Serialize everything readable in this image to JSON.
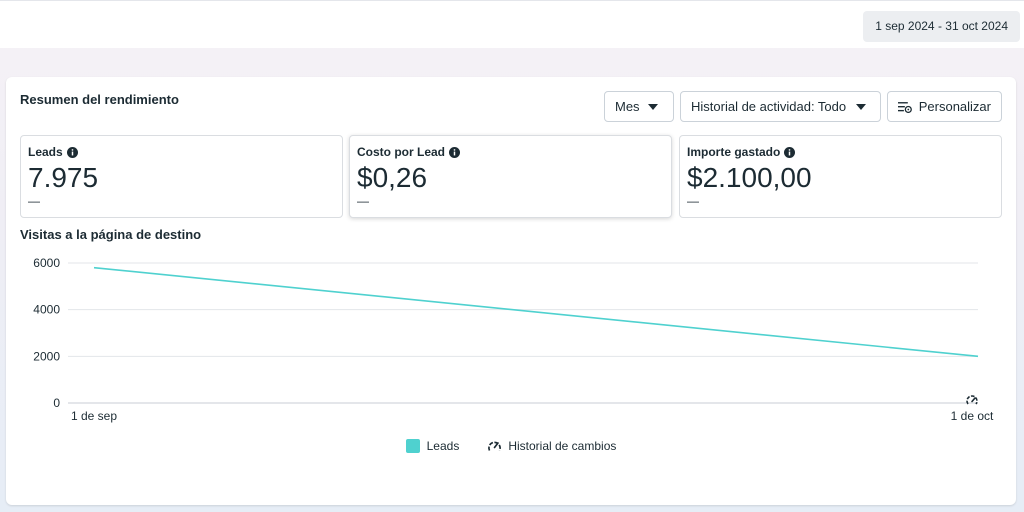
{
  "header": {
    "date_range": "1 sep 2024 - 31 oct 2024"
  },
  "summary": {
    "title": "Resumen del rendimiento",
    "controls": {
      "period": "Mes",
      "history": "Historial de actividad: Todo",
      "customize": "Personalizar"
    },
    "metrics": [
      {
        "label": "Leads",
        "value": "7.975",
        "delta": "—"
      },
      {
        "label": "Costo por Lead",
        "value": "$0,26",
        "delta": "—"
      },
      {
        "label": "Importe gastado",
        "value": "$2.100,00",
        "delta": "—"
      }
    ]
  },
  "colors": {
    "series": "#4fd1cf",
    "accent": "#1c2b33"
  },
  "chart_data": {
    "type": "line",
    "title": "Visitas a la página de destino",
    "x": [
      "1 de sep",
      "1 de oct"
    ],
    "series": [
      {
        "name": "Leads",
        "values": [
          5800,
          2000
        ]
      }
    ],
    "ylim": [
      0,
      6000
    ],
    "yticks": [
      "0",
      "2000",
      "4000",
      "6000"
    ],
    "grid": true,
    "legend": [
      "Leads",
      "Historial de cambios"
    ],
    "legend_position": "bottom-center"
  }
}
